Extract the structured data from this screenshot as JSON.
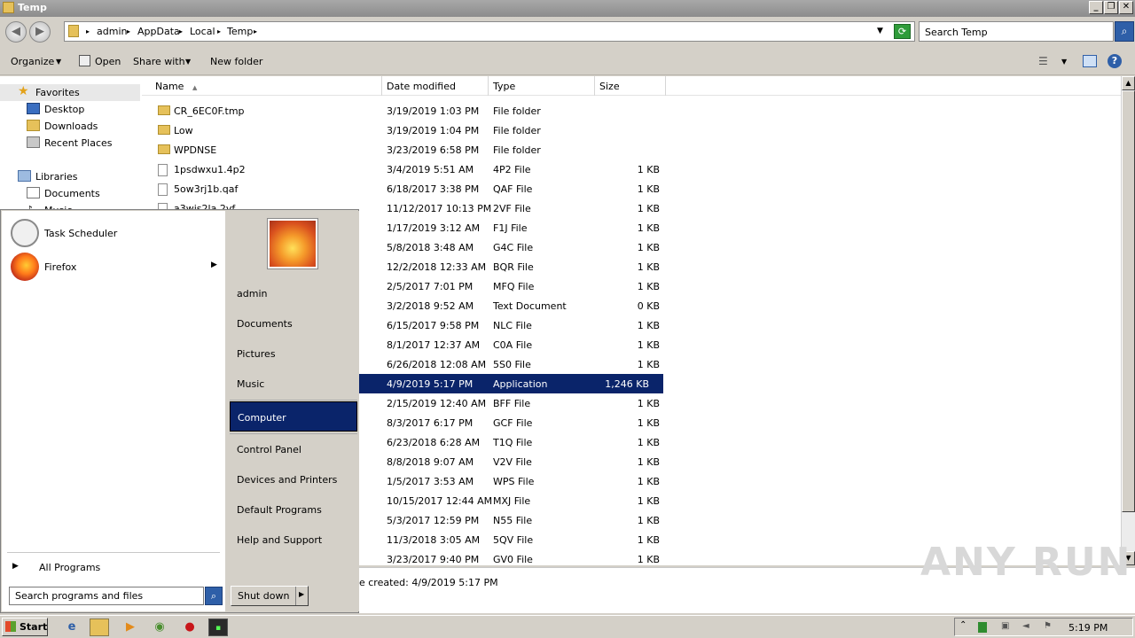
{
  "window": {
    "title": "Temp",
    "buttons": [
      "_",
      "❐",
      "✕"
    ]
  },
  "address": {
    "crumbs": [
      "admin",
      "AppData",
      "Local",
      "Temp"
    ],
    "search_placeholder": "Search Temp"
  },
  "toolbar": {
    "organize": "Organize",
    "open": "Open",
    "share_with": "Share with",
    "new_folder": "New folder"
  },
  "nav": {
    "favorites": "Favorites",
    "desktop": "Desktop",
    "downloads": "Downloads",
    "recent_places": "Recent Places",
    "libraries": "Libraries",
    "documents": "Documents",
    "music_partial": "Music"
  },
  "columns": {
    "name": "Name",
    "date": "Date modified",
    "type": "Type",
    "size": "Size"
  },
  "files": [
    {
      "name": "CR_6EC0F.tmp",
      "date": "3/19/2019 1:03 PM",
      "type": "File folder",
      "size": "",
      "kind": "folder"
    },
    {
      "name": "Low",
      "date": "3/19/2019 1:04 PM",
      "type": "File folder",
      "size": "",
      "kind": "folder"
    },
    {
      "name": "WPDNSE",
      "date": "3/23/2019 6:58 PM",
      "type": "File folder",
      "size": "",
      "kind": "folder"
    },
    {
      "name": "1psdwxu1.4p2",
      "date": "3/4/2019 5:51 AM",
      "type": "4P2 File",
      "size": "1 KB",
      "kind": "file"
    },
    {
      "name": "5ow3rj1b.qaf",
      "date": "6/18/2017 3:38 PM",
      "type": "QAF File",
      "size": "1 KB",
      "kind": "file"
    },
    {
      "name": "a3wis2la.2vf",
      "date": "11/12/2017 10:13 PM",
      "type": "2VF File",
      "size": "1 KB",
      "kind": "file"
    },
    {
      "name": "",
      "date": "1/17/2019 3:12 AM",
      "type": "F1J File",
      "size": "1 KB",
      "kind": "file"
    },
    {
      "name": "",
      "date": "5/8/2018 3:48 AM",
      "type": "G4C File",
      "size": "1 KB",
      "kind": "file"
    },
    {
      "name": "",
      "date": "12/2/2018 12:33 AM",
      "type": "BQR File",
      "size": "1 KB",
      "kind": "file"
    },
    {
      "name": "",
      "date": "2/5/2017 7:01 PM",
      "type": "MFQ File",
      "size": "1 KB",
      "kind": "file"
    },
    {
      "name": "",
      "date": "3/2/2018 9:52 AM",
      "type": "Text Document",
      "size": "0 KB",
      "kind": "file"
    },
    {
      "name": "",
      "date": "6/15/2017 9:58 PM",
      "type": "NLC File",
      "size": "1 KB",
      "kind": "file"
    },
    {
      "name": "",
      "date": "8/1/2017 12:37 AM",
      "type": "C0A File",
      "size": "1 KB",
      "kind": "file"
    },
    {
      "name": "",
      "date": "6/26/2018 12:08 AM",
      "type": "5S0 File",
      "size": "1 KB",
      "kind": "file"
    },
    {
      "name": "",
      "date": "4/9/2019 5:17 PM",
      "type": "Application",
      "size": "1,246 KB",
      "kind": "file",
      "selected": true
    },
    {
      "name": "",
      "date": "2/15/2019 12:40 AM",
      "type": "BFF File",
      "size": "1 KB",
      "kind": "file"
    },
    {
      "name": "",
      "date": "8/3/2017 6:17 PM",
      "type": "GCF File",
      "size": "1 KB",
      "kind": "file"
    },
    {
      "name": "",
      "date": "6/23/2018 6:28 AM",
      "type": "T1Q File",
      "size": "1 KB",
      "kind": "file"
    },
    {
      "name": "",
      "date": "8/8/2018 9:07 AM",
      "type": "V2V File",
      "size": "1 KB",
      "kind": "file"
    },
    {
      "name": "",
      "date": "1/5/2017 3:53 AM",
      "type": "WPS File",
      "size": "1 KB",
      "kind": "file"
    },
    {
      "name": "",
      "date": "10/15/2017 12:44 AM",
      "type": "MXJ File",
      "size": "1 KB",
      "kind": "file"
    },
    {
      "name": "",
      "date": "5/3/2017 12:59 PM",
      "type": "N55 File",
      "size": "1 KB",
      "kind": "file"
    },
    {
      "name": "",
      "date": "11/3/2018 3:05 AM",
      "type": "5QV File",
      "size": "1 KB",
      "kind": "file"
    },
    {
      "name": "",
      "date": "3/23/2017 9:40 PM",
      "type": "GV0 File",
      "size": "1 KB",
      "kind": "file"
    }
  ],
  "details": {
    "text": "e created: 4/9/2019 5:17 PM"
  },
  "start_menu": {
    "programs": [
      "Task Scheduler",
      "Firefox"
    ],
    "all_programs": "All Programs",
    "search_placeholder": "Search programs and files",
    "links": [
      "admin",
      "Documents",
      "Pictures",
      "Music",
      "Computer",
      "Control Panel",
      "Devices and Printers",
      "Default Programs",
      "Help and Support"
    ],
    "shutdown": "Shut down"
  },
  "taskbar": {
    "start": "Start",
    "clock": "5:19 PM"
  },
  "watermark": "ANY RUN",
  "colors": {
    "selection": "#0a246a",
    "window_bg": "#d4d0c8"
  }
}
